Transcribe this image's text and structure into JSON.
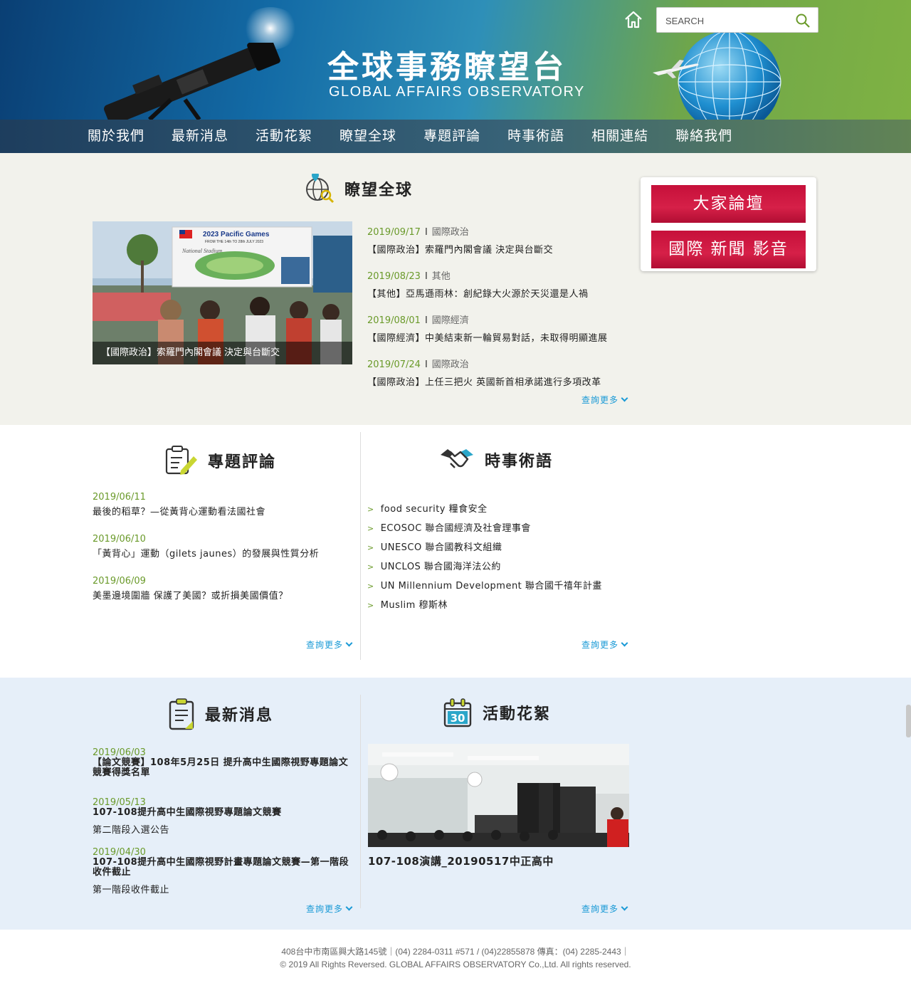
{
  "header": {
    "title": "全球事務瞭望台",
    "subtitle": "GLOBAL AFFAIRS OBSERVATORY",
    "search_placeholder": "SEARCH"
  },
  "nav": {
    "items": [
      "關於我們",
      "最新消息",
      "活動花絮",
      "瞭望全球",
      "專題評論",
      "時事術語",
      "相關連結",
      "聯絡我們"
    ]
  },
  "global": {
    "heading": "瞭望全球",
    "feature_caption": "【國際政治】索羅門內閣會議 決定與台斷交",
    "news": [
      {
        "date": "2019/09/17",
        "sep": "I",
        "category": "國際政治",
        "title": "【國際政治】索羅門內閣會議 決定與台斷交"
      },
      {
        "date": "2019/08/23",
        "sep": "I",
        "category": "其他",
        "title": "【其他】亞馬遜雨林：創紀錄大火源於天災還是人禍"
      },
      {
        "date": "2019/08/01",
        "sep": "I",
        "category": "國際經濟",
        "title": "【國際經濟】中美結束新一輪貿易對話，未取得明顯進展"
      },
      {
        "date": "2019/07/24",
        "sep": "I",
        "category": "國際政治",
        "title": "【國際政治】上任三把火 英國新首相承諾進行多項改革"
      }
    ],
    "more": "查詢更多"
  },
  "side": {
    "forum": "大家論壇",
    "media": "國際 新聞 影音"
  },
  "commentary": {
    "heading": "專題評論",
    "items": [
      {
        "date": "2019/06/11",
        "title": "最後的稻草？—從黃背心運動看法國社會"
      },
      {
        "date": "2019/06/10",
        "title": "「黃背心」運動（gilets jaunes）的發展與性質分析"
      },
      {
        "date": "2019/06/09",
        "title": "美墨邊境圍牆 保護了美國？或折損美國價值？"
      }
    ],
    "more": "查詢更多"
  },
  "terms": {
    "heading": "時事術語",
    "items": [
      "food security 糧食安全",
      "ECOSOC 聯合國經濟及社會理事會",
      "UNESCO 聯合國教科文組織",
      "UNCLOS 聯合國海洋法公約",
      "UN Millennium Development 聯合國千禧年計畫",
      "Muslim 穆斯林"
    ],
    "more": "查詢更多"
  },
  "latest": {
    "heading": "最新消息",
    "items": [
      {
        "date": "2019/06/03",
        "title": "【論文競賽】108年5月25日 提升高中生國際視野專題論文競賽得獎名單",
        "sub": ""
      },
      {
        "date": "2019/05/13",
        "title": "107-108提升高中生國際視野專題論文競賽",
        "sub": "第二階段入選公告"
      },
      {
        "date": "2019/04/30",
        "title": "107-108提升高中生國際視野計畫專題論文競賽—第一階段收件截止",
        "sub": "第一階段收件截止"
      }
    ],
    "more": "查詢更多"
  },
  "events": {
    "heading": "活動花絮",
    "caption": "107-108演講_20190517中正高中",
    "calendar_day": "30",
    "more": "查詢更多"
  },
  "feature_image_text": {
    "games": "2023 Pacific Games",
    "dates": "FROM THE 14th TO 28th JULY 2023",
    "stadium": "National Stadium"
  },
  "footer": {
    "address": "408台中市南區興大路145號｜(04) 2284-0311 #571 / (04)22855878 傳真：(04) 2285-2443｜",
    "copyright": "© 2019 All Rights Reversed. GLOBAL AFFAIRS OBSERVATORY Co.,Ltd. All rights reserved."
  },
  "colors": {
    "accent_green": "#6a9a2a",
    "link_blue": "#1a9ad6",
    "button_red": "#c6103a"
  }
}
